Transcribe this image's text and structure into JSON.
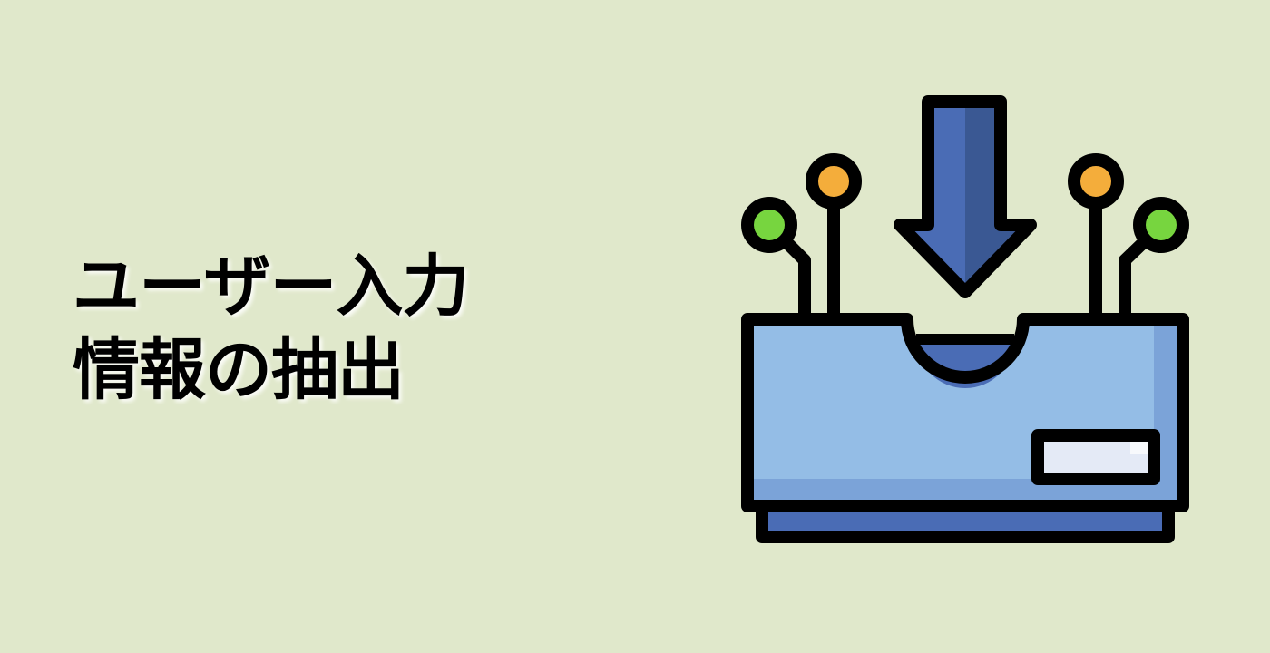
{
  "title": {
    "line1": "ユーザー入力",
    "line2": "情報の抽出"
  },
  "icon": {
    "name": "inbox-download-icon",
    "colors": {
      "background": "#e0e8cb",
      "outline": "#000000",
      "arrow_main": "#4a6cb5",
      "arrow_shade": "#3a5893",
      "tray_body": "#94bde6",
      "tray_shade": "#7ba3d8",
      "tray_base": "#4a6cb5",
      "label_fill": "#e4eaf6",
      "node_green": "#77d53f",
      "node_orange": "#f4ad3b"
    }
  }
}
